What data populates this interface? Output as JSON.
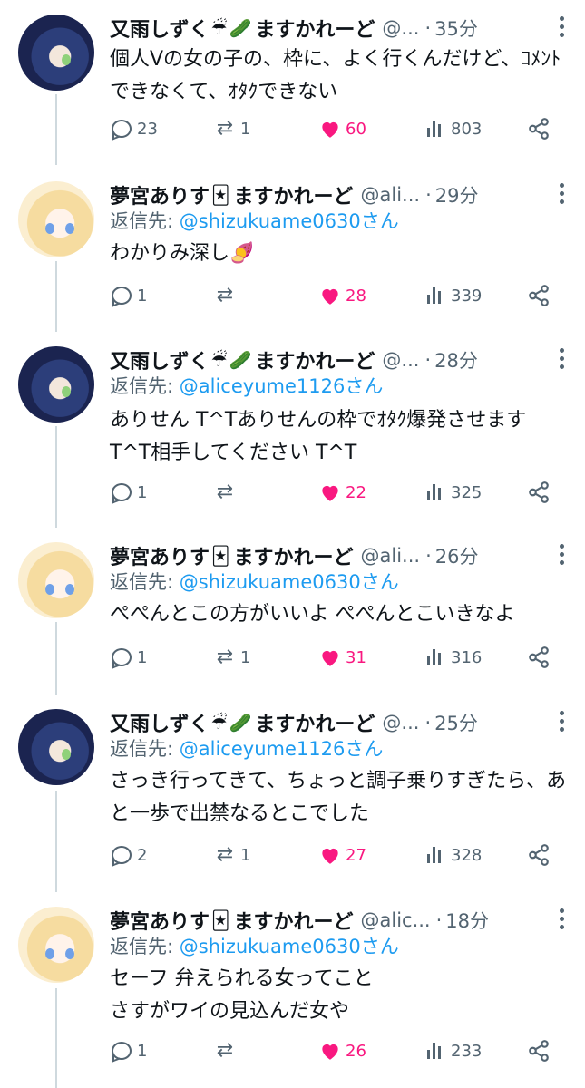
{
  "colors": {
    "like": "#f91880",
    "mention": "#1d9bf0",
    "muted": "#536471",
    "thread_line": "#cfd9de"
  },
  "tweets": [
    {
      "name": "又雨しずく",
      "badge": "☔",
      "badge2": "🥒",
      "suffix": "ますかれーど",
      "handle": "@...",
      "dot": "·",
      "time": "35分",
      "reply_to": null,
      "body": "個人Vの女の子の、枠に、よく行くんだけど、ｺﾒﾝﾄできなくて、ｵﾀｸできない",
      "replies": "23",
      "retweets": "1",
      "likes": "60",
      "views": "803",
      "avatar": "shizuku"
    },
    {
      "name": "夢宮ありす",
      "badge": "🃏",
      "badge2": "",
      "suffix": "ますかれーど",
      "handle": "@ali...",
      "dot": "·",
      "time": "29分",
      "reply_to": {
        "prefix": "返信先: ",
        "mention": "@shizukuame0630さん"
      },
      "body": "わかりみ深し🍠",
      "replies": "1",
      "retweets": "",
      "likes": "28",
      "views": "339",
      "avatar": "alice"
    },
    {
      "name": "又雨しずく",
      "badge": "☔",
      "badge2": "🥒",
      "suffix": "ますかれーど",
      "handle": "@...",
      "dot": "·",
      "time": "28分",
      "reply_to": {
        "prefix": "返信先: ",
        "mention": "@aliceyume1126さん"
      },
      "body": "ありせん T^Tありせんの枠でｵﾀｸ爆発させます T^T相手してください T^T",
      "replies": "1",
      "retweets": "",
      "likes": "22",
      "views": "325",
      "avatar": "shizuku"
    },
    {
      "name": "夢宮ありす",
      "badge": "🃏",
      "badge2": "",
      "suffix": "ますかれーど",
      "handle": "@ali...",
      "dot": "·",
      "time": "26分",
      "reply_to": {
        "prefix": "返信先: ",
        "mention": "@shizukuame0630さん"
      },
      "body": "ぺぺんとこの方がいいよ ぺぺんとこいきなよ",
      "replies": "1",
      "retweets": "1",
      "likes": "31",
      "views": "316",
      "avatar": "alice"
    },
    {
      "name": "又雨しずく",
      "badge": "☔",
      "badge2": "🥒",
      "suffix": "ますかれーど",
      "handle": "@...",
      "dot": "·",
      "time": "25分",
      "reply_to": {
        "prefix": "返信先: ",
        "mention": "@aliceyume1126さん"
      },
      "body": "さっき行ってきて、ちょっと調子乗りすぎたら、あと一歩で出禁なるとこでした",
      "replies": "2",
      "retweets": "1",
      "likes": "27",
      "views": "328",
      "avatar": "shizuku"
    },
    {
      "name": "夢宮ありす",
      "badge": "🃏",
      "badge2": "",
      "suffix": "ますかれーど",
      "handle": "@alic...",
      "dot": "·",
      "time": "18分",
      "reply_to": {
        "prefix": "返信先: ",
        "mention": "@shizukuame0630さん"
      },
      "body": "セーフ 弁えられる女ってこと\nさすがワイの見込んだ女や",
      "replies": "1",
      "retweets": "",
      "likes": "26",
      "views": "233",
      "avatar": "alice"
    }
  ]
}
